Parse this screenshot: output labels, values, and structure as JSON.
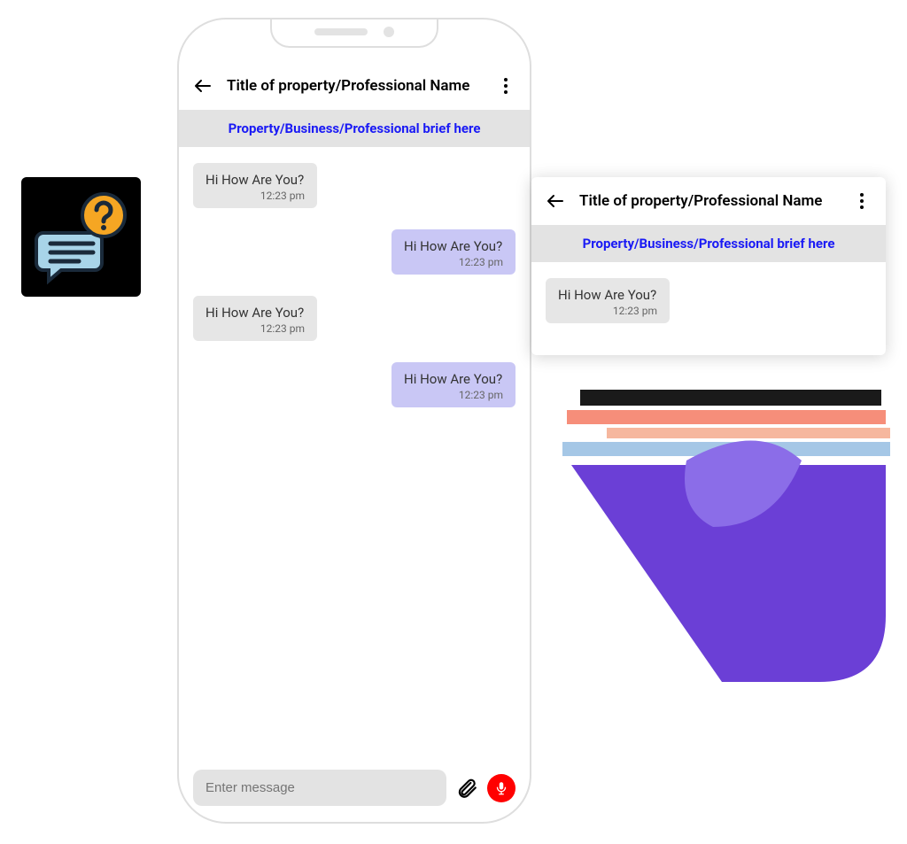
{
  "phone": {
    "header": {
      "title": "Title of property/Professional Name"
    },
    "banner": "Property/Business/Professional brief here",
    "messages": [
      {
        "text": "Hi How Are You?",
        "time": "12:23 pm",
        "side": "left"
      },
      {
        "text": "Hi How Are You?",
        "time": "12:23 pm",
        "side": "right"
      },
      {
        "text": "Hi How Are You?",
        "time": "12:23 pm",
        "side": "left"
      },
      {
        "text": "Hi How Are You?",
        "time": "12:23 pm",
        "side": "right"
      }
    ],
    "composer": {
      "placeholder": "Enter message"
    }
  },
  "card": {
    "header": {
      "title": "Title of property/Professional Name"
    },
    "banner": "Property/Business/Professional brief here",
    "messages": [
      {
        "text": "Hi How Are You?",
        "time": "12:23 pm",
        "side": "left"
      }
    ]
  }
}
